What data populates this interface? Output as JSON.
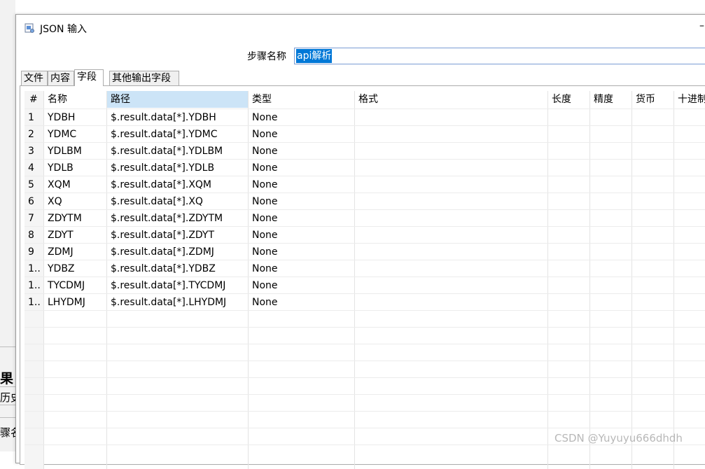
{
  "background": {
    "fragments": [
      "果",
      "历史",
      "骤名"
    ]
  },
  "dialog": {
    "title": "JSON 输入",
    "minimize_glyph": "–",
    "step_name_label": "步骤名称",
    "step_name_value": "api解析"
  },
  "tabs": [
    {
      "label": "文件",
      "active": false
    },
    {
      "label": "内容",
      "active": false
    },
    {
      "label": "字段",
      "active": true
    },
    {
      "label": "其他输出字段",
      "active": false
    }
  ],
  "table": {
    "columns": [
      "#",
      "名称",
      "路径",
      "类型",
      "格式",
      "长度",
      "精度",
      "货币",
      "十进制"
    ],
    "selected_column": "路径",
    "rows": [
      {
        "num": "1",
        "name": "YDBH",
        "path": "$.result.data[*].YDBH",
        "type": "None"
      },
      {
        "num": "2",
        "name": "YDMC",
        "path": "$.result.data[*].YDMC",
        "type": "None"
      },
      {
        "num": "3",
        "name": "YDLBM",
        "path": "$.result.data[*].YDLBM",
        "type": "None"
      },
      {
        "num": "4",
        "name": "YDLB",
        "path": "$.result.data[*].YDLB",
        "type": "None"
      },
      {
        "num": "5",
        "name": "XQM",
        "path": "$.result.data[*].XQM",
        "type": "None"
      },
      {
        "num": "6",
        "name": "XQ",
        "path": "$.result.data[*].XQ",
        "type": "None"
      },
      {
        "num": "7",
        "name": "ZDYTM",
        "path": "$.result.data[*].ZDYTM",
        "type": "None"
      },
      {
        "num": "8",
        "name": "ZDYT",
        "path": "$.result.data[*].ZDYT",
        "type": "None"
      },
      {
        "num": "9",
        "name": "ZDMJ",
        "path": "$.result.data[*].ZDMJ",
        "type": "None"
      },
      {
        "num": "1..",
        "name": "YDBZ",
        "path": "$.result.data[*].YDBZ",
        "type": "None"
      },
      {
        "num": "1..",
        "name": "TYCDMJ",
        "path": "$.result.data[*].TYCDMJ",
        "type": "None"
      },
      {
        "num": "1..",
        "name": "LHYDMJ",
        "path": "$.result.data[*].LHYDMJ",
        "type": "None"
      }
    ]
  },
  "watermark": "CSDN @Yuyuyu666dhdh",
  "icons": {
    "app": "json-input-icon",
    "sort": "sort-caret-icon"
  }
}
